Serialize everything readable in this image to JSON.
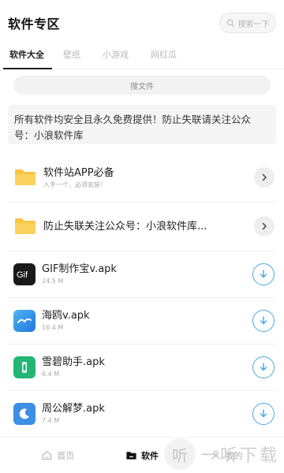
{
  "header": {
    "title": "软件专区",
    "search_label": "搜索一下"
  },
  "tabs": [
    {
      "label": "软件大全",
      "active": true
    },
    {
      "label": "壁纸"
    },
    {
      "label": "小游戏"
    },
    {
      "label": "网红瓜"
    }
  ],
  "search_bar": {
    "placeholder": "搜文件"
  },
  "notice": {
    "text": "所有软件均安全且永久免费提供！防止失联请关注公众号：小浪软件库"
  },
  "folders": [
    {
      "name": "软件站APP必备",
      "sub": "入手一个，必须安装！"
    },
    {
      "name": "防止失联关注公众号：小浪软件库..."
    }
  ],
  "apps": [
    {
      "name": "GIF制作宝v.apk",
      "size": "24.5 M",
      "icon": "gif-app-icon",
      "color": "#1a1a1a"
    },
    {
      "name": "海鸥v.apk",
      "size": "16.4 M",
      "icon": "seagull-app-icon",
      "color": "#2a8ce8"
    },
    {
      "name": "雪碧助手.apk",
      "size": "6.4 M",
      "icon": "sprite-app-icon",
      "color": "#22b573"
    },
    {
      "name": "周公解梦.apk",
      "size": "7.4 M",
      "icon": "dream-app-icon",
      "color": "#3b8fe6"
    }
  ],
  "bottom_nav": [
    {
      "label": "首页",
      "icon": "home-icon"
    },
    {
      "label": "软件",
      "icon": "folder-icon",
      "active": true
    },
    {
      "label": "我的",
      "icon": "user-icon"
    }
  ],
  "watermark": {
    "badge": "听",
    "text": "一听下载"
  },
  "colors": {
    "accent": "#4aa8e8",
    "folder": "#f8c444"
  }
}
